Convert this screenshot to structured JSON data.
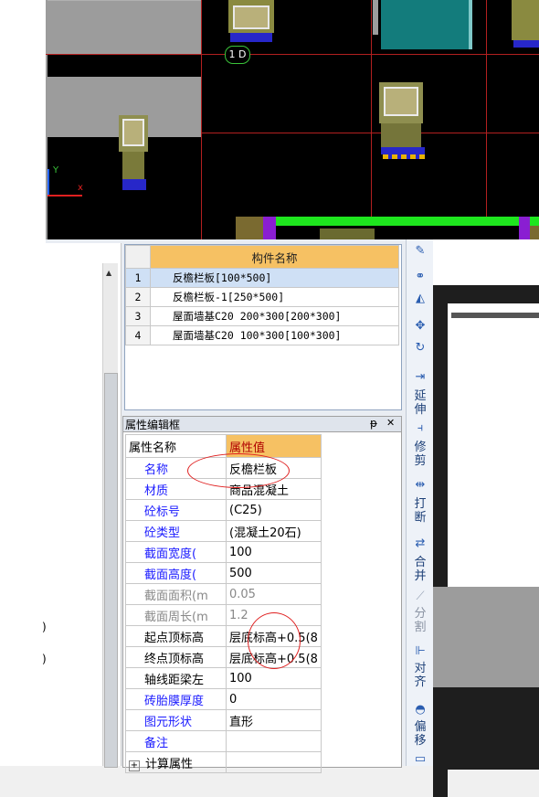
{
  "viewport": {
    "grid_label": "1 D",
    "axis_y": "Y"
  },
  "component_list": {
    "header": "构件名称",
    "rows": [
      {
        "index": "1",
        "name": "反檐栏板[100*500]"
      },
      {
        "index": "2",
        "name": "反檐栏板-1[250*500]"
      },
      {
        "index": "3",
        "name": "屋面墙基C20 200*300[200*300]"
      },
      {
        "index": "4",
        "name": "屋面墙基C20 100*300[100*300]"
      }
    ]
  },
  "property_editor": {
    "title": "属性编辑框",
    "pin_label": "ᵽ",
    "close_label": "✕",
    "col_name": "属性名称",
    "col_value": "属性值",
    "rows": [
      {
        "name": "名称",
        "value": "反檐栏板"
      },
      {
        "name": "材质",
        "value": "商品混凝土"
      },
      {
        "name": "砼标号",
        "value": "(C25)"
      },
      {
        "name": "砼类型",
        "value": "(混凝土20石)"
      },
      {
        "name": "截面宽度(",
        "value": "100"
      },
      {
        "name": "截面高度(",
        "value": "500"
      },
      {
        "name": "截面面积(m",
        "value": "0.05"
      },
      {
        "name": "截面周长(m",
        "value": "1.2"
      },
      {
        "name": "起点顶标高",
        "value": "层底标高+0.5(8"
      },
      {
        "name": "终点顶标高",
        "value": "层底标高+0.5(8"
      },
      {
        "name": "轴线距梁左",
        "value": "100"
      },
      {
        "name": "砖胎膜厚度",
        "value": "0"
      },
      {
        "name": "图元形状",
        "value": "直形"
      },
      {
        "name": "备注",
        "value": ""
      },
      {
        "name": "计算属性",
        "value": ""
      }
    ],
    "expand_label": "+"
  },
  "toolbar": {
    "extend": "延伸",
    "trim": "修剪",
    "break": "打断",
    "merge": "合并",
    "split": "分割",
    "align": "对齐",
    "offset": "偏移"
  },
  "left_fragments": [
    ")",
    ")"
  ]
}
